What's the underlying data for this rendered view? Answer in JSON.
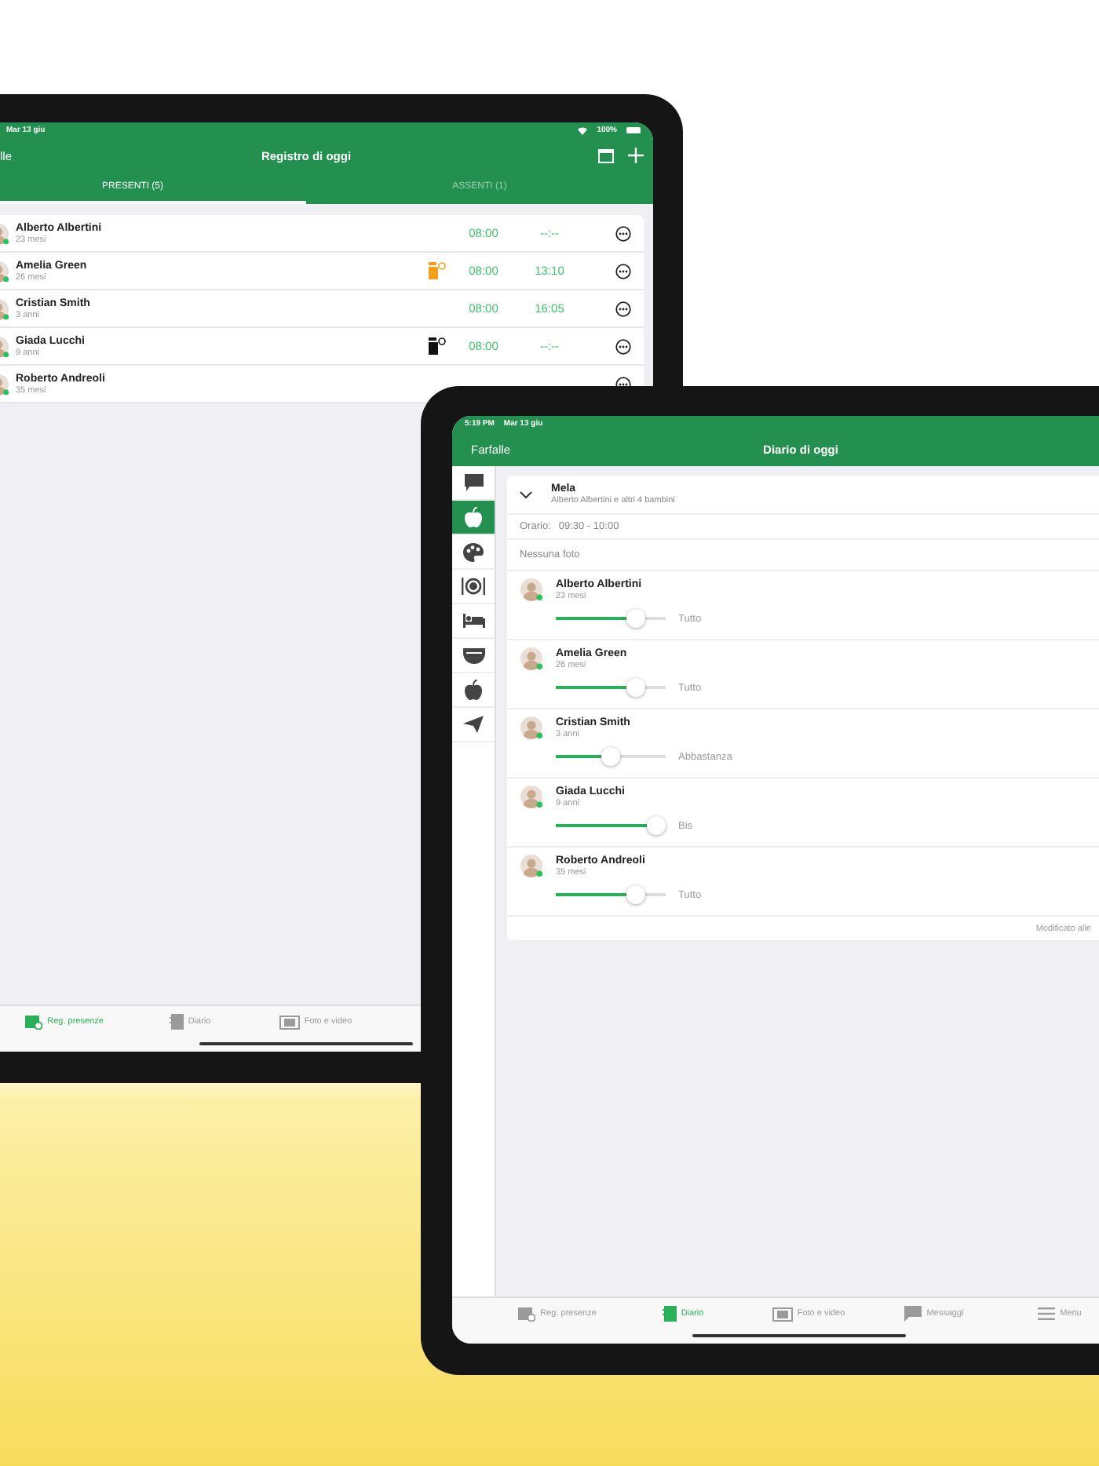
{
  "back_device": {
    "status_bar": {
      "date": "Mar 13 giu",
      "battery": "100%"
    },
    "header": {
      "back": "lle",
      "title": "Registro di oggi"
    },
    "tabs": [
      {
        "label": "PRESENTI (5)",
        "selected": true
      },
      {
        "label": "ASSENTI (1)",
        "selected": false
      }
    ],
    "attendance": [
      {
        "name": "Alberto Albertini",
        "age": "23 mesi",
        "check_in": "08:00",
        "check_out": "--:--"
      },
      {
        "name": "Amelia Green",
        "age": "26 mesi",
        "color": "#f5a01a",
        "check_in": "08:00",
        "check_out": "13:10"
      },
      {
        "name": "Cristian Smith",
        "age": "3 anni",
        "check_in": "08:00",
        "check_out": "16:05"
      },
      {
        "name": "Giada Lucchi",
        "age": "9 anni",
        "color": "#111111",
        "check_in": "08:00",
        "check_out": "--:--"
      },
      {
        "name": "Roberto Andreoli",
        "age": "35 mesi"
      }
    ],
    "tab_bar": [
      {
        "kind": "attendance",
        "label": "Reg. presenze",
        "selected": true
      },
      {
        "kind": "diary",
        "label": "Diario",
        "selected": false
      },
      {
        "kind": "media",
        "label": "Foto e video",
        "selected": false
      }
    ]
  },
  "front_device": {
    "status_bar": {
      "time": "5:19 PM",
      "date": "Mar 13 giu"
    },
    "header": {
      "back": "Farfalle",
      "title": "Diario di oggi"
    },
    "sidebar": [
      {
        "kind": "message",
        "selected": false
      },
      {
        "kind": "apple",
        "selected": true
      },
      {
        "kind": "palette",
        "selected": false
      },
      {
        "kind": "plate",
        "selected": false
      },
      {
        "kind": "bed",
        "selected": false
      },
      {
        "kind": "diaper",
        "selected": false
      },
      {
        "kind": "apple",
        "selected": false
      },
      {
        "kind": "send",
        "selected": false
      }
    ],
    "entry": {
      "title": "Mela",
      "subtitle": "Alberto Albertini e altri 4 bambini",
      "schedule_label": "Orario:",
      "schedule": "09:30 - 10:00",
      "photos": "Nessuna foto",
      "children": [
        {
          "name": "Alberto Albertini",
          "age": "23 mesi",
          "level": 0.77,
          "amount": "Tutto"
        },
        {
          "name": "Amelia Green",
          "age": "26 mesi",
          "level": 0.77,
          "amount": "Tutto"
        },
        {
          "name": "Cristian Smith",
          "age": "3 anni",
          "level": 0.5,
          "amount": "Abbastanza"
        },
        {
          "name": "Giada Lucchi",
          "age": "9 anni",
          "level": 1,
          "amount": "Bis"
        },
        {
          "name": "Roberto Andreoli",
          "age": "35 mesi",
          "level": 0.77,
          "amount": "Tutto"
        }
      ],
      "footer": "Modificato alle"
    },
    "tab_bar": [
      {
        "kind": "attendance",
        "label": "Reg. presenze",
        "selected": false
      },
      {
        "kind": "diary",
        "label": "Diario",
        "selected": true
      },
      {
        "kind": "media",
        "label": "Foto e video",
        "selected": false
      },
      {
        "kind": "messages",
        "label": "Messaggi",
        "selected": false
      },
      {
        "kind": "menu",
        "label": "Menu",
        "selected": false
      }
    ]
  }
}
